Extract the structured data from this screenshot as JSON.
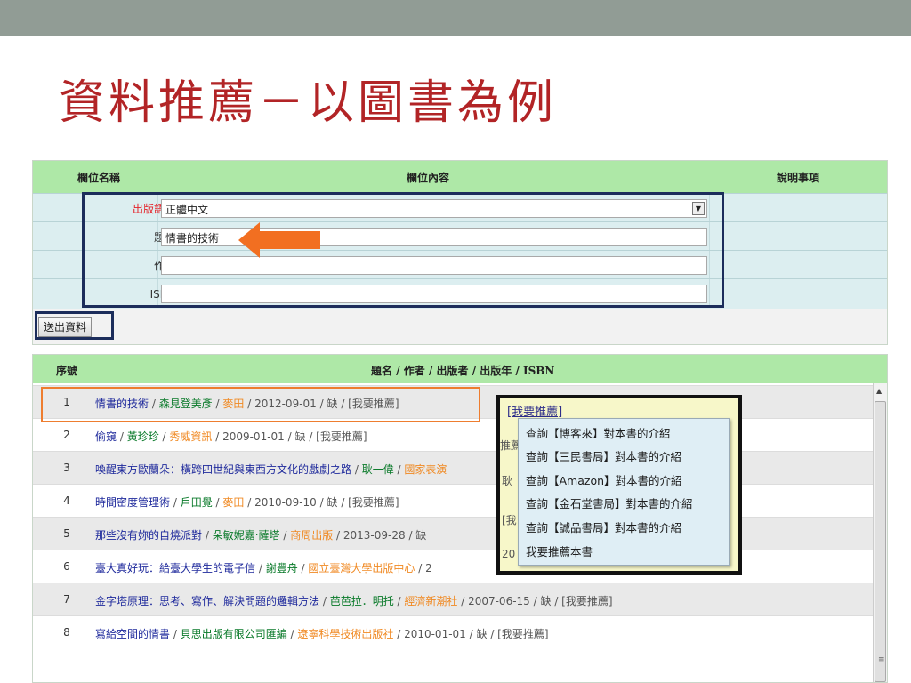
{
  "slide": {
    "title": "資料推薦－以圖書為例"
  },
  "form": {
    "headers": {
      "field_name": "欄位名稱",
      "field_content": "欄位內容",
      "notes": "說明事項"
    },
    "rows": [
      {
        "label": "出版語文：",
        "value": "正體中文",
        "type": "select"
      },
      {
        "label": "題名：",
        "value": "情書的技術",
        "type": "input"
      },
      {
        "label": "作者：",
        "value": "",
        "type": "input"
      },
      {
        "label": "ISBN：",
        "value": "",
        "type": "input"
      }
    ],
    "submit_label": "送出資料"
  },
  "results": {
    "headers": {
      "index": "序號",
      "info": "題名 / 作者 / 出版者 / 出版年 / ISBN"
    },
    "separator": " / ",
    "rows": [
      {
        "n": "1",
        "title": "情書的技術",
        "author": "森見登美彥",
        "pub": "麥田",
        "year": "2012-09-01",
        "isbn": "缺",
        "rec": "[我要推薦]"
      },
      {
        "n": "2",
        "title": "偷窺",
        "author": "黃珍珍",
        "pub": "秀威資訊",
        "year": "2009-01-01",
        "isbn": "缺",
        "rec": "[我要推薦]"
      },
      {
        "n": "3",
        "title": "喚醒東方歐蘭朵：橫跨四世紀與東西方文化的戲劇之路",
        "author": "耿一偉",
        "pub": "國家表演",
        "year": "",
        "isbn": "",
        "rec": ""
      },
      {
        "n": "4",
        "title": "時間密度管理術",
        "author": "戶田覺",
        "pub": "麥田",
        "year": "2010-09-10",
        "isbn": "缺",
        "rec": "[我要推薦]"
      },
      {
        "n": "5",
        "title": "那些沒有妳的自燒派對",
        "author": "朵敏妮嘉‧薩塔",
        "pub": "商周出版",
        "year": "2013-09-28",
        "isbn": "缺",
        "rec": ""
      },
      {
        "n": "6",
        "title": "臺大真好玩：給臺大學生的電子信",
        "author": "謝豐舟",
        "pub": "國立臺灣大學出版中心",
        "year": "2",
        "isbn": "",
        "rec": ""
      },
      {
        "n": "7",
        "title": "金字塔原理：思考、寫作、解決問題的邏輯方法",
        "author": "芭芭拉．明托",
        "pub": "經濟新潮社",
        "year": "2007-06-15",
        "isbn": "缺",
        "rec": "[我要推薦]"
      },
      {
        "n": "8",
        "title": "寫給空間的情書",
        "author": "貝思出版有限公司匯編",
        "pub": "遼寧科學技術出版社",
        "year": "2010-01-01",
        "isbn": "缺",
        "rec": "[我要推薦]"
      }
    ]
  },
  "popup": {
    "link": "[我要推薦]",
    "menu": [
      "查詢【博客來】對本書的介紹",
      "查詢【三民書局】對本書的介紹",
      "查詢【Amazon】對本書的介紹",
      "查詢【金石堂書局】對本書的介紹",
      "查詢【誠品書局】對本書的介紹",
      "我要推薦本書"
    ],
    "bg_fragments": [
      "推薦",
      "耿",
      "[我",
      "20"
    ]
  },
  "colors": {
    "title_red": "#b22426",
    "header_green": "#aee8a7",
    "form_bg": "#dceef0",
    "highlight_navy": "#1c2d5b",
    "highlight_orange": "#ee7d2f",
    "arrow_orange": "#f26f21"
  }
}
